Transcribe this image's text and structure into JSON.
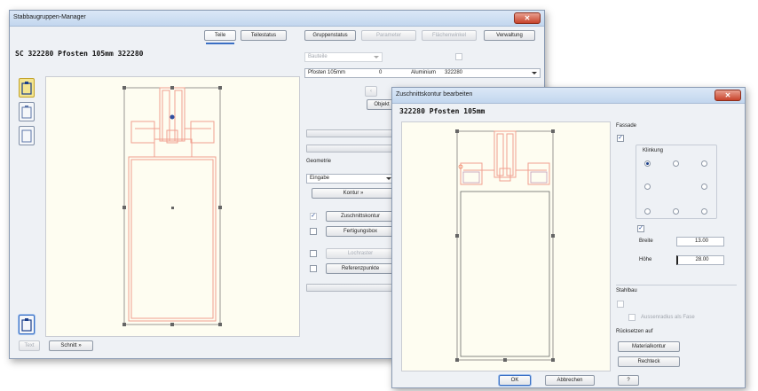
{
  "main_window": {
    "title": "Stabbaugruppen-Manager",
    "close_label": "✕",
    "tabs": [
      {
        "label": "Teile",
        "active": true
      },
      {
        "label": "Teilestatus",
        "active": false
      },
      {
        "label": "Gruppenstatus",
        "active": false
      },
      {
        "label": "Parameter",
        "active": false
      },
      {
        "label": "Flächenwinkel",
        "active": false
      },
      {
        "label": "Verwaltung",
        "active": false
      }
    ],
    "heading": "SC  322280 Pfosten 105mm 322280",
    "bauteile_select": "Bauteile",
    "part_row": {
      "name": "Pfosten 105mm",
      "count": "0",
      "material": "Aluminium",
      "code": "322280"
    },
    "objekt_button": "Objekt",
    "geometrie_label": "Geometrie",
    "eingabe_select": "Eingabe",
    "kontur_button": "Kontur »",
    "zuschnittskontur_button": "Zuschnittskontur",
    "fertigungsbox_button": "Fertigungsbox",
    "lochraster_button": "Lochraster",
    "referenzpunkte_button": "Referenzpunkte",
    "bottom_left_button": "Text",
    "schnitt_button": "Schnitt »"
  },
  "dialog": {
    "title": "Zuschnittskontur bearbeiten",
    "heading": "322280 Pfosten 105mm",
    "fassade_label": "Fassade",
    "fassade_checked": true,
    "klinkung_label": "Klinkung",
    "klinkung_checked": true,
    "breite_label": "Breite",
    "breite_value": "13.00",
    "hoehe_label": "Höhe",
    "hoehe_value": "28.00",
    "stahlbau_label": "Stahlbau",
    "aussenradius_label": "Aussenradius als Fase",
    "ruecksetzen_label": "Rücksetzen auf",
    "materialkontur_button": "Materialkontur",
    "rechteck_button": "Rechteck",
    "ok_button": "OK",
    "abbrechen_button": "Abbrechen",
    "help_button": "?"
  },
  "colors": {
    "profile_line": "#f0a090",
    "canvas_bg": "#fefdf1",
    "active_tab_underline": "#3a6fc4"
  }
}
